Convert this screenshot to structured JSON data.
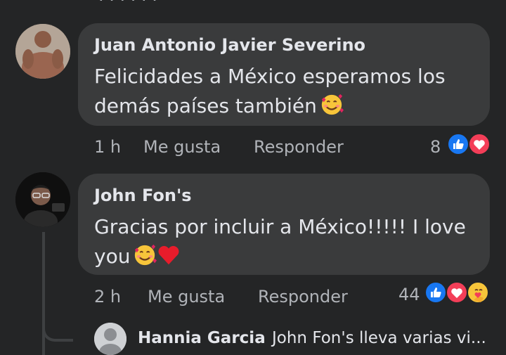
{
  "top_fragment": "· · · · · ·",
  "comments": [
    {
      "author": "Juan Antonio Javier Severino",
      "text_line1": "Felicidades a México esperamos los",
      "text_line2": "demás países también",
      "time": "1 h",
      "like_label": "Me gusta",
      "reply_label": "Responder",
      "reaction_count": "8",
      "reactions": [
        "like",
        "love"
      ],
      "text_emojis": [
        "smiling-face-with-hearts"
      ]
    },
    {
      "author": "John Fon's",
      "text_line1": "Gracias por incluir a México!!!!! I love",
      "text_line2": "you",
      "time": "2 h",
      "like_label": "Me gusta",
      "reply_label": "Responder",
      "reaction_count": "44",
      "reactions": [
        "like",
        "love",
        "care"
      ],
      "text_emojis": [
        "smiling-face-with-hearts",
        "red-heart"
      ]
    }
  ],
  "reply_preview": {
    "author": "Hannia Garcia",
    "text": "John Fon's lleva varias vi..."
  },
  "colors": {
    "background": "#242526",
    "bubble": "#3a3b3c",
    "primary_text": "#e4e6eb",
    "secondary_text": "#b0b3b8",
    "like_blue": "#1877f2",
    "love_red": "#f33e58"
  }
}
